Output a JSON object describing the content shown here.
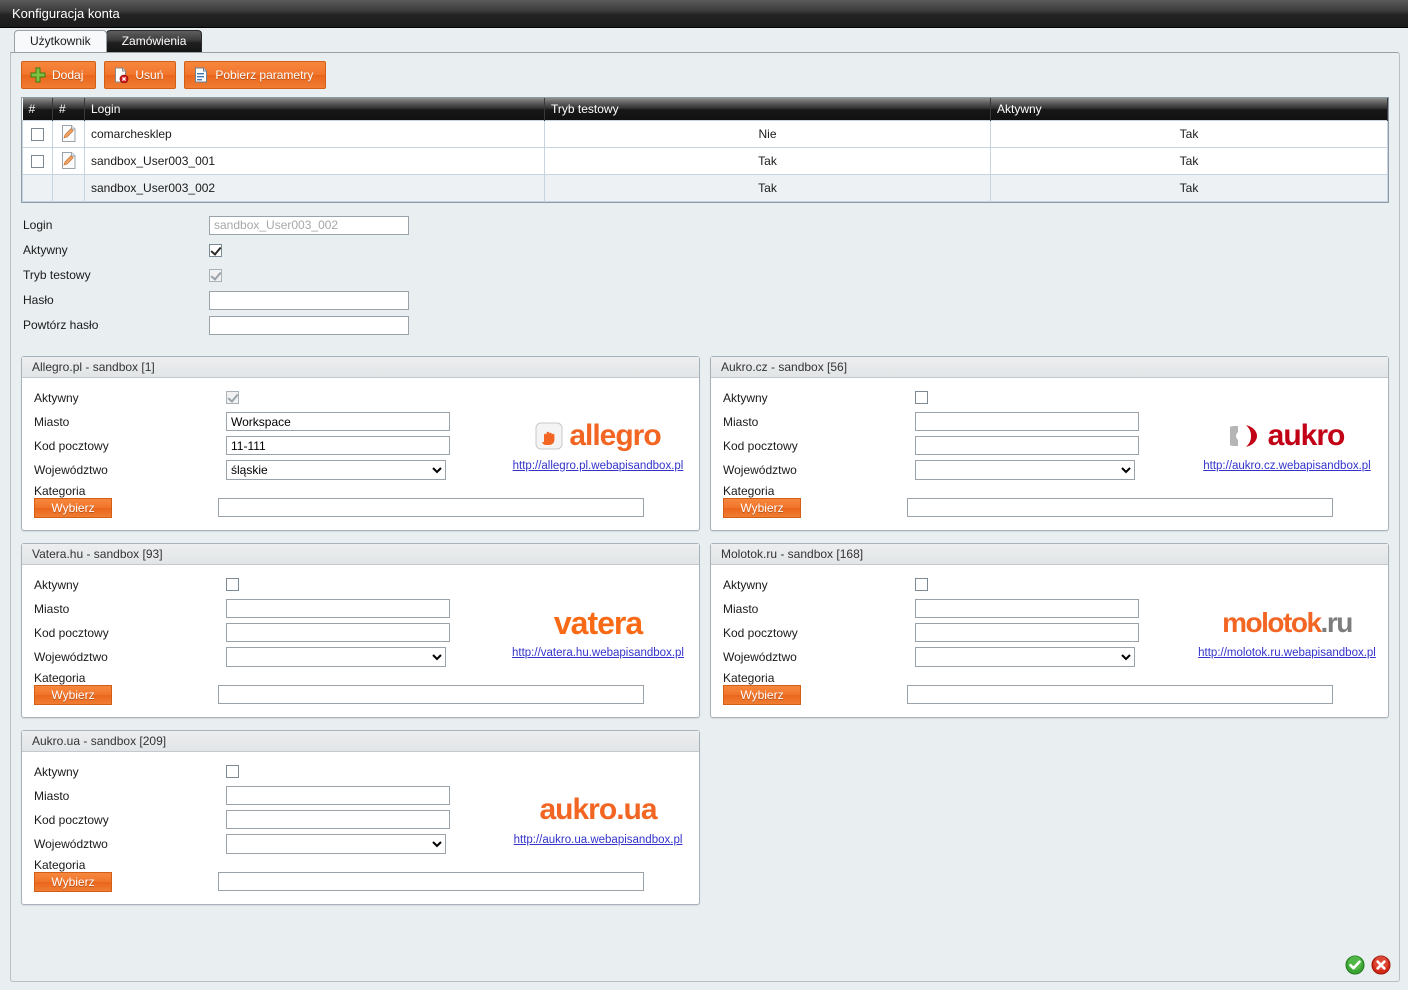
{
  "window": {
    "title": "Konfiguracja konta"
  },
  "tabs": [
    {
      "label": "Użytkownik",
      "active": true
    },
    {
      "label": "Zamówienia",
      "active": false
    }
  ],
  "toolbar": {
    "add_label": "Dodaj",
    "delete_label": "Usuń",
    "fetch_label": "Pobierz parametry",
    "add_icon": "plus-icon",
    "delete_icon": "page-delete-icon",
    "fetch_icon": "document-icon",
    "button_color": "#f1742a"
  },
  "grid": {
    "columns": [
      "#",
      "#",
      "Login",
      "Tryb testowy",
      "Aktywny"
    ],
    "rows": [
      {
        "checked": false,
        "has_edit": true,
        "login": "comarchesklep",
        "test_mode": "Nie",
        "active": "Tak",
        "selected": false
      },
      {
        "checked": false,
        "has_edit": true,
        "login": "sandbox_User003_001",
        "test_mode": "Tak",
        "active": "Tak",
        "selected": false
      },
      {
        "checked": false,
        "has_edit": false,
        "login": "sandbox_User003_002",
        "test_mode": "Tak",
        "active": "Tak",
        "selected": true
      }
    ]
  },
  "form": {
    "login_label": "Login",
    "login_value": "sandbox_User003_002",
    "active_label": "Aktywny",
    "active_checked": true,
    "test_mode_label": "Tryb testowy",
    "test_mode_checked": true,
    "password_label": "Hasło",
    "password_value": "",
    "password_repeat_label": "Powtórz hasło",
    "password_repeat_value": ""
  },
  "labels": {
    "active": "Aktywny",
    "city": "Miasto",
    "postcode": "Kod pocztowy",
    "region": "Województwo",
    "category": "Kategoria",
    "choose": "Wybierz"
  },
  "panels": [
    {
      "id": "allegro-pl",
      "title": "Allegro.pl - sandbox [1]",
      "active_checked": true,
      "active_disabled": true,
      "city": "Workspace",
      "postcode": "11-111",
      "region": "śląskie",
      "category": "",
      "link": "http://allegro.pl.webapisandbox.pl",
      "logo_text": "allegro",
      "logo_style": "allegro"
    },
    {
      "id": "aukro-cz",
      "title": "Aukro.cz - sandbox [56]",
      "active_checked": false,
      "active_disabled": false,
      "city": "",
      "postcode": "",
      "region": "",
      "category": "",
      "link": "http://aukro.cz.webapisandbox.pl",
      "logo_text": "aukro",
      "logo_style": "aukro"
    },
    {
      "id": "vatera-hu",
      "title": "Vatera.hu - sandbox [93]",
      "active_checked": false,
      "active_disabled": false,
      "city": "",
      "postcode": "",
      "region": "",
      "category": "",
      "link": "http://vatera.hu.webapisandbox.pl",
      "logo_text": "vatera",
      "logo_style": "vatera"
    },
    {
      "id": "molotok-ru",
      "title": "Molotok.ru - sandbox [168]",
      "active_checked": false,
      "active_disabled": false,
      "city": "",
      "postcode": "",
      "region": "",
      "category": "",
      "link": "http://molotok.ru.webapisandbox.pl",
      "logo_text": "molotok.ru",
      "logo_style": "molotok"
    },
    {
      "id": "aukro-ua",
      "title": "Aukro.ua - sandbox [209]",
      "active_checked": false,
      "active_disabled": false,
      "city": "",
      "postcode": "",
      "region": "",
      "category": "",
      "link": "http://aukro.ua.webapisandbox.pl",
      "logo_text": "aukro.ua",
      "logo_style": "aukroua"
    }
  ],
  "status": {
    "accept_icon": "green-check-icon",
    "cancel_icon": "red-cross-icon",
    "accept_color": "#3aa532",
    "cancel_color": "#d32a18"
  }
}
